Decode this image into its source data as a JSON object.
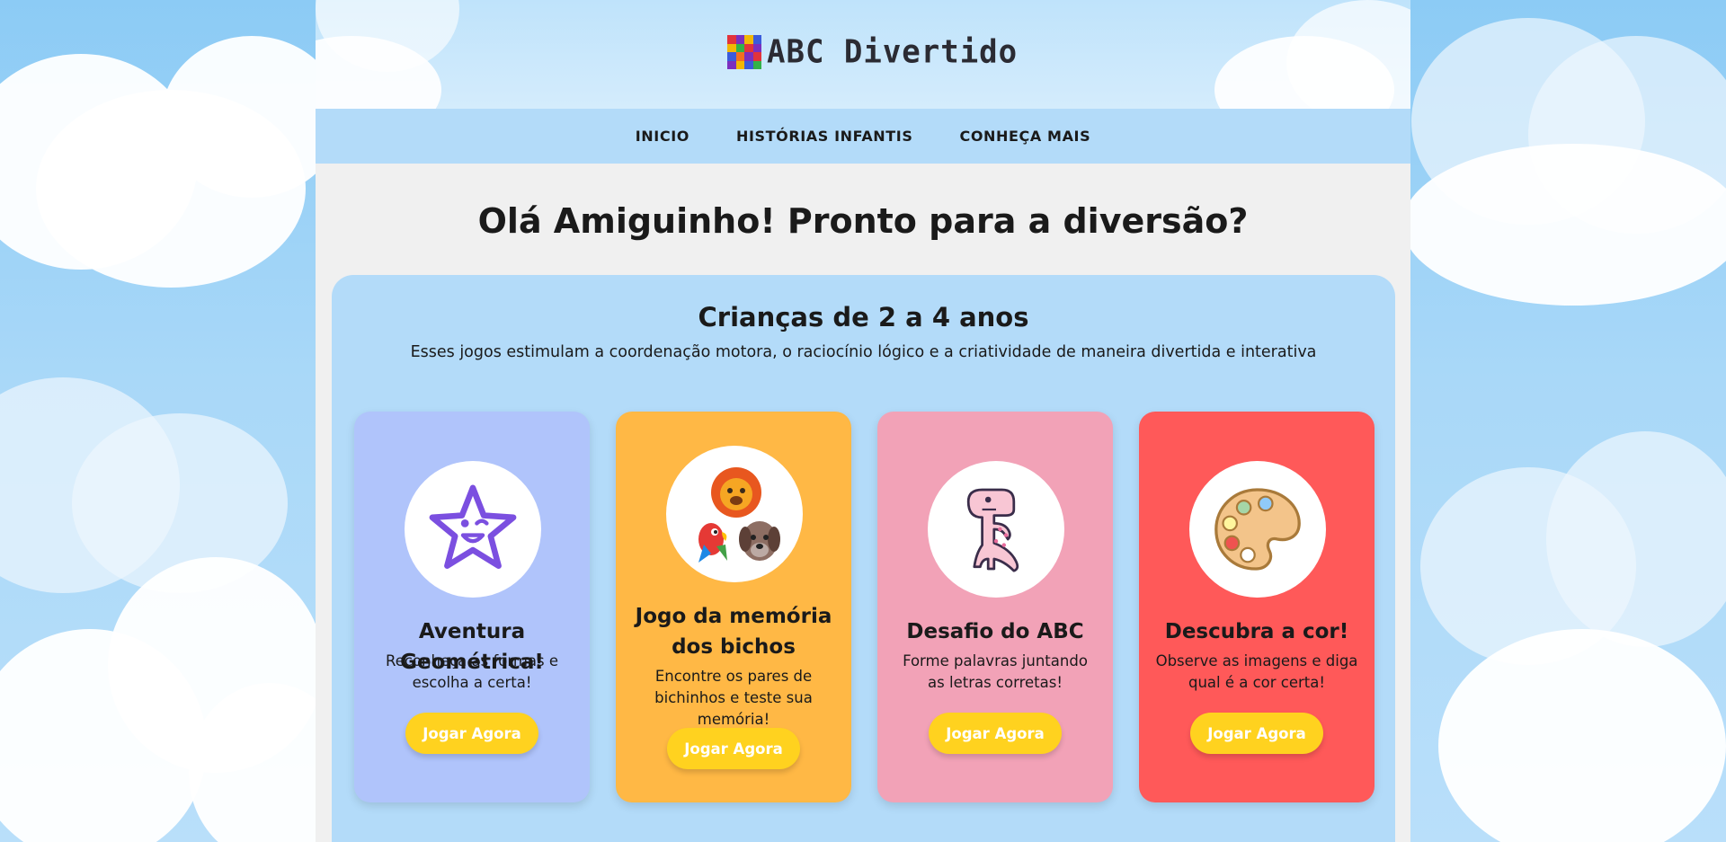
{
  "brand": {
    "name": "ABC Divertido",
    "logo_colors": [
      "#e2333b",
      "#f2b705",
      "#3b5bdb",
      "#7b2fbf",
      "#33b249",
      "#f36f21"
    ]
  },
  "nav": {
    "items": [
      {
        "label": "INICIO"
      },
      {
        "label": "HISTÓRIAS INFANTIS"
      },
      {
        "label": "CONHEÇA MAIS"
      }
    ]
  },
  "hero": {
    "title": "Olá Amiguinho! Pronto para a diversão?"
  },
  "section": {
    "title": "Crianças de 2 a 4 anos",
    "description": "Esses jogos estimulam a coordenação motora, o raciocínio lógico e a criatividade de maneira divertida e interativa"
  },
  "cards": [
    {
      "title": "Aventura Geométrica!",
      "description": "Reconheça as formas e escolha a certa!",
      "button": "Jogar Agora",
      "color": "#b0c4fb",
      "icon": "star-face-icon"
    },
    {
      "title": "Jogo da memória dos bichos",
      "description": "Encontre os pares de bichinhos e teste sua memória!",
      "button": "Jogar Agora",
      "color": "#ffb845",
      "icon": "animals-icon"
    },
    {
      "title": "Desafio do ABC",
      "description": "Forme palavras juntando as letras corretas!",
      "button": "Jogar Agora",
      "color": "#f2a2b7",
      "icon": "dinosaur-icon"
    },
    {
      "title": "Descubra a cor!",
      "description": "Observe as imagens e diga qual é a cor certa!",
      "button": "Jogar Agora",
      "color": "#ff5959",
      "icon": "palette-icon"
    }
  ],
  "colors": {
    "sky": "#8ccbf5",
    "panel": "#b3dbf9",
    "button": "#ffd21f"
  }
}
